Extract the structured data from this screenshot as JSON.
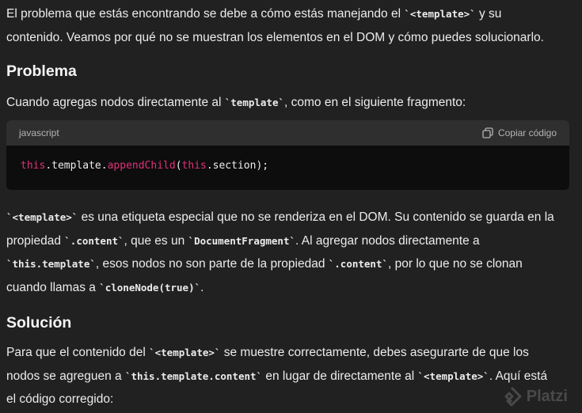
{
  "intro": {
    "t1": "El problema que estás encontrando se debe a cómo estás manejando el ",
    "c1": "`<template>`",
    "t2": " y su",
    "line2": "contenido. Veamos por qué no se muestran los elementos en el DOM y cómo puedes solucionarlo."
  },
  "problem": {
    "heading": "Problema",
    "p1_text": "Cuando agregas nodos directamente al ",
    "p1_code": "`template`",
    "p1_rest": ", como en el siguiente fragmento:"
  },
  "codeblock": {
    "language": "javascript",
    "copy_label": "Copiar código",
    "copy_icon": "copy-icon",
    "tok_this1": "this",
    "tok_dot1": ".template.",
    "tok_fn": "appendChild",
    "tok_paren": "(",
    "tok_this2": "this",
    "tok_rest": ".section);"
  },
  "explain": {
    "l1_code": "`<template>`",
    "l1_text": " es una etiqueta especial que no se renderiza en el DOM. Su contenido se guarda en la",
    "l2_text": "propiedad ",
    "l2_code1": "`.content`",
    "l2_text2": ", que es un ",
    "l2_code2": "`DocumentFragment`",
    "l2_text3": ". Al agregar nodos directamente a",
    "l3_code1": "`this.template`",
    "l3_text": ", esos nodos no son parte de la propiedad ",
    "l3_code2": "`.content`",
    "l3_text2": ", por lo que no se clonan",
    "l4_text": "cuando llamas a ",
    "l4_code": "`cloneNode(true)`",
    "l4_text2": "."
  },
  "solution": {
    "heading": "Solución",
    "l1_text": "Para que el contenido del ",
    "l1_code": "`<template>`",
    "l1_text2": " se muestre correctamente, debes asegurarte de que los",
    "l2_text": "nodos se agreguen a ",
    "l2_code1": "`this.template.content`",
    "l2_text2": " en lugar de directamente al ",
    "l2_code2": "`<template>`",
    "l2_text3": ". Aquí está",
    "l3_text": "el código corregido:"
  },
  "watermark": {
    "text": "Platzi",
    "icon": "platzi-logo-icon"
  }
}
